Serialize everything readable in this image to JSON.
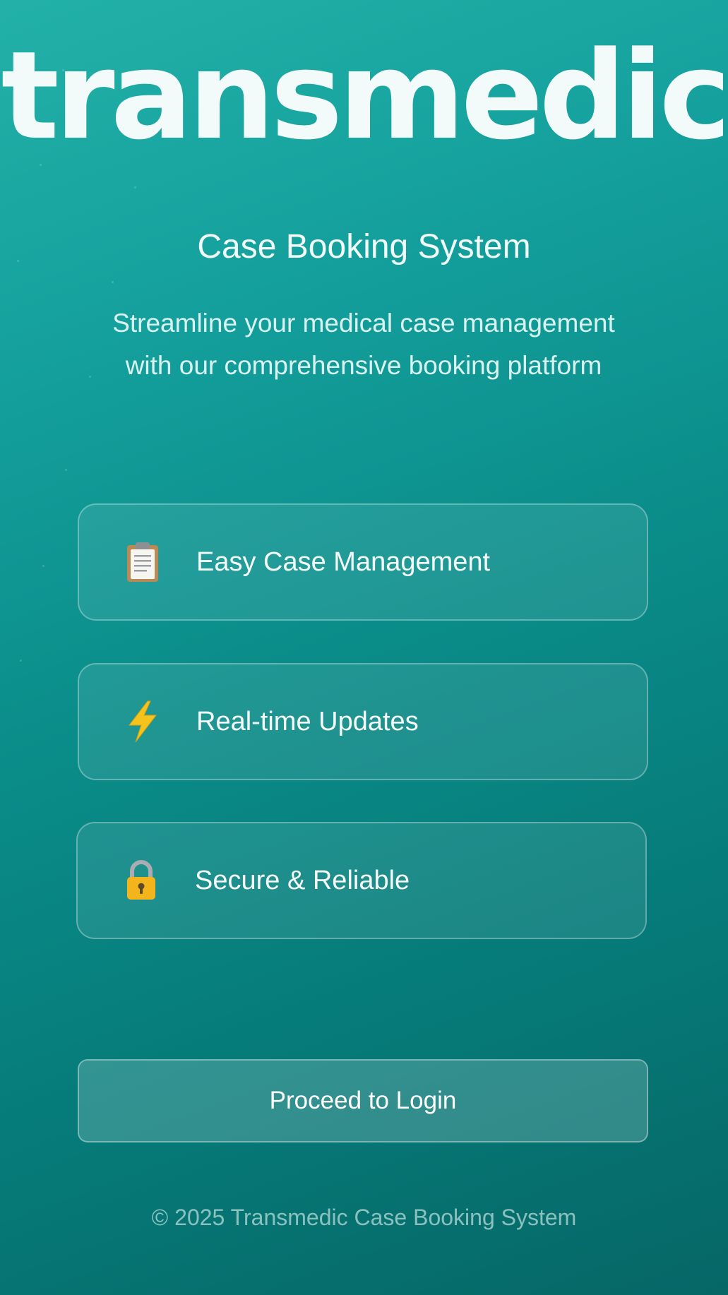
{
  "brand": {
    "logo_text": "transmedic"
  },
  "hero": {
    "subtitle": "Case Booking System",
    "tagline_line1": "Streamline your medical case management",
    "tagline_line2": "with our comprehensive booking platform"
  },
  "features": [
    {
      "icon": "clipboard-icon",
      "label": "Easy Case Management"
    },
    {
      "icon": "lightning-icon",
      "label": "Real-time Updates"
    },
    {
      "icon": "lock-icon",
      "label": "Secure & Reliable"
    }
  ],
  "login": {
    "button_label": "Proceed to Login"
  },
  "footer": {
    "copyright": "© 2025 Transmedic Case Booking System"
  },
  "colors": {
    "background_start": "#22b1a8",
    "background_end": "#066766",
    "text": "#ffffff"
  }
}
